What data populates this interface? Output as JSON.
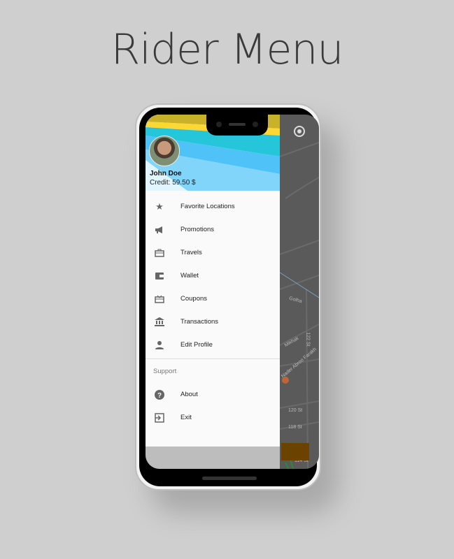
{
  "page_title": "Rider Menu",
  "user": {
    "name": "John Doe",
    "credit": "Credit: 59.50 $"
  },
  "menu": [
    {
      "label": "Favorite Locations",
      "icon": "star-icon"
    },
    {
      "label": "Promotions",
      "icon": "megaphone-icon"
    },
    {
      "label": "Travels",
      "icon": "briefcase-icon"
    },
    {
      "label": "Wallet",
      "icon": "wallet-icon"
    },
    {
      "label": "Coupons",
      "icon": "gift-card-icon"
    },
    {
      "label": "Transactions",
      "icon": "bank-icon"
    },
    {
      "label": "Edit Profile",
      "icon": "person-icon"
    }
  ],
  "support": {
    "heading": "Support",
    "items": [
      {
        "label": "About",
        "icon": "help-icon"
      },
      {
        "label": "Exit",
        "icon": "exit-icon"
      }
    ]
  },
  "map_labels": {
    "golha": "Golha",
    "mikhak": "Mikhak",
    "st122": "122 St",
    "nader": "Nader Abroo Farakh",
    "st120": "120 St",
    "st118": "118 St",
    "st114": "114 St"
  }
}
